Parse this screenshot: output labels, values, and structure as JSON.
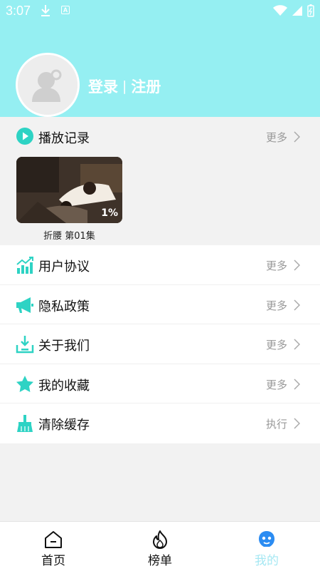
{
  "status_bar": {
    "time": "3:07",
    "a_badge": "A"
  },
  "profile": {
    "login_label": "登录",
    "separator": "|",
    "register_label": "注册"
  },
  "history": {
    "title": "播放记录",
    "more_label": "更多",
    "items": [
      {
        "title": "折腰 第01集",
        "progress": "1%"
      }
    ]
  },
  "menu": [
    {
      "label": "用户协议",
      "action": "更多",
      "icon": "chart-growth-icon"
    },
    {
      "label": "隐私政策",
      "action": "更多",
      "icon": "megaphone-icon"
    },
    {
      "label": "关于我们",
      "action": "更多",
      "icon": "download-tray-icon"
    },
    {
      "label": "我的收藏",
      "action": "更多",
      "icon": "star-icon"
    },
    {
      "label": "清除缓存",
      "action": "执行",
      "icon": "broom-icon"
    }
  ],
  "tabs": [
    {
      "label": "首页",
      "icon": "home-icon",
      "active": false
    },
    {
      "label": "榜单",
      "icon": "flame-icon",
      "active": false
    },
    {
      "label": "我的",
      "icon": "robot-face-icon",
      "active": true
    }
  ],
  "colors": {
    "header_bg": "#95eff2",
    "accent": "#2ed3c4",
    "active_tab": "#a6e8f3"
  }
}
